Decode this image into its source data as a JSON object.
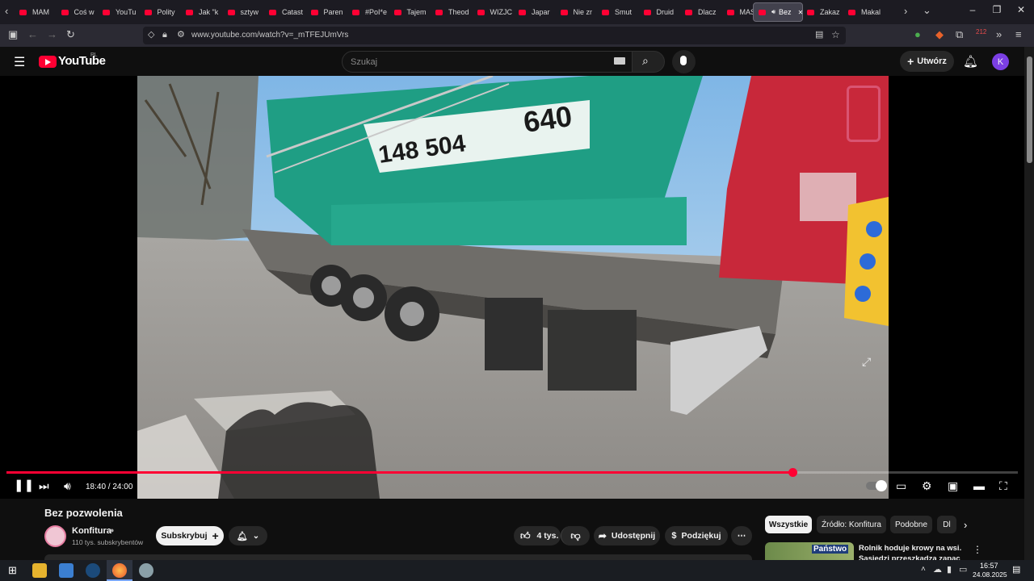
{
  "browser": {
    "tabs": [
      {
        "label": "MAM"
      },
      {
        "label": "Coś w"
      },
      {
        "label": "YouTu"
      },
      {
        "label": "Polity"
      },
      {
        "label": "Jak \"k"
      },
      {
        "label": "sztyw"
      },
      {
        "label": "Catast"
      },
      {
        "label": "Paren"
      },
      {
        "label": "#PoI*e"
      },
      {
        "label": "Tajem"
      },
      {
        "label": "Theod"
      },
      {
        "label": "WIZJC"
      },
      {
        "label": "Japar"
      },
      {
        "label": "Nie zr"
      },
      {
        "label": "Smut"
      },
      {
        "label": "Druid"
      },
      {
        "label": "Dlacz"
      },
      {
        "label": "MASA"
      },
      {
        "label": "Bez"
      },
      {
        "label": "Zakaz"
      },
      {
        "label": "Makal"
      }
    ],
    "url": "www.youtube.com/watch?v=_mTFEJUmVrs",
    "badge_count": "212"
  },
  "youtube": {
    "logo_text": "YouTube",
    "logo_region": "PL",
    "search_placeholder": "Szukaj",
    "create_label": "Utwórz",
    "avatar_letter": "K"
  },
  "player": {
    "time_current": "18:40",
    "time_total": "24:00",
    "time_display": "18:40 / 24:00",
    "progress_fraction": 0.777
  },
  "video": {
    "title": "Bez pozwolenia",
    "channel": "Konfitura",
    "subscribers": "110 tys. subskrybentów",
    "subscribe_label": "Subskrybuj",
    "likes": "4 tys.",
    "share_label": "Udostępnij",
    "thanks_label": "Podziękuj"
  },
  "chips": [
    {
      "label": "Wszystkie"
    },
    {
      "label": "Źródło: Konfitura"
    },
    {
      "label": "Podobne"
    },
    {
      "label": "Dl"
    }
  ],
  "recommendation": {
    "thumb_text": "Państwo",
    "title": "Rolnik hoduje krowy na wsi. Sąsiedzi przeszkadza zapac"
  },
  "taskbar": {
    "time": "16:57",
    "date": "24.08.2025"
  },
  "colors": {
    "accent": "#ff0033",
    "avatar": "#7b3fe4",
    "crane_green": "#1f9e84"
  }
}
